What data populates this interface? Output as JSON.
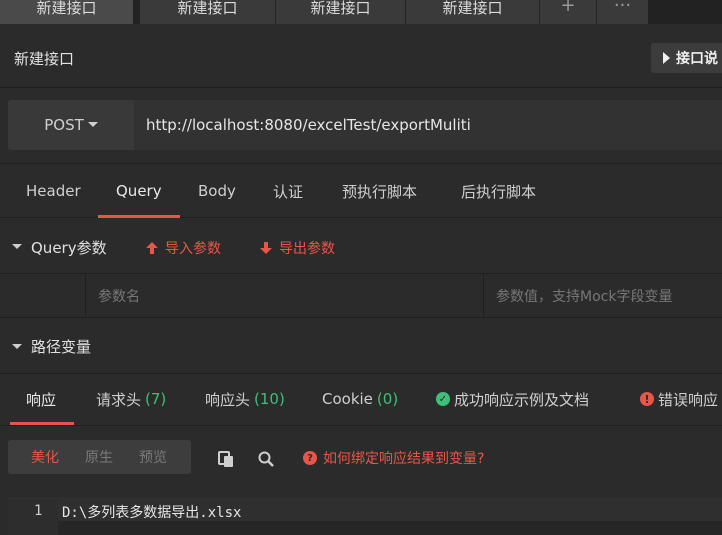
{
  "tabs": [
    {
      "label": "新建接口",
      "active": true
    },
    {
      "label": "新建接口",
      "active": false
    },
    {
      "label": "新建接口",
      "active": false
    },
    {
      "label": "新建接口",
      "active": false
    }
  ],
  "tab_actions": {
    "add_icon": "plus-icon",
    "more_icon": "more-icon",
    "add": "+",
    "more": "···"
  },
  "header": {
    "title": "新建接口",
    "doc_button": "接口说"
  },
  "request": {
    "method": "POST",
    "url": "http://localhost:8080/excelTest/exportMuliti"
  },
  "request_tabs": [
    {
      "label": "Header",
      "active": false
    },
    {
      "label": "Query",
      "active": true
    },
    {
      "label": "Body",
      "active": false
    },
    {
      "label": "认证",
      "active": false
    },
    {
      "label": "预执行脚本",
      "active": false
    },
    {
      "label": "后执行脚本",
      "active": false
    }
  ],
  "query": {
    "title": "Query参数",
    "import_label": "导入参数",
    "export_label": "导出参数",
    "name_placeholder": "参数名",
    "value_placeholder": "参数值，支持Mock字段变量"
  },
  "path_vars": {
    "title": "路径变量"
  },
  "response_tabs": {
    "response": "响应",
    "req_headers": "请求头",
    "req_headers_count": "(7)",
    "resp_headers": "响应头",
    "resp_headers_count": "(10)",
    "cookie": "Cookie",
    "cookie_count": "(0)",
    "success_doc": "成功响应示例及文档",
    "error_doc": "错误响应"
  },
  "response_toolbar": {
    "beautify": "美化",
    "raw": "原生",
    "preview": "预览",
    "help": "如何绑定响应结果到变量?"
  },
  "editor": {
    "line_number": "1",
    "content": "D:\\多列表多数据导出.xlsx"
  },
  "colors": {
    "accent": "#e8564a",
    "success": "#3fbf7a",
    "background": "#2b2b2b"
  }
}
